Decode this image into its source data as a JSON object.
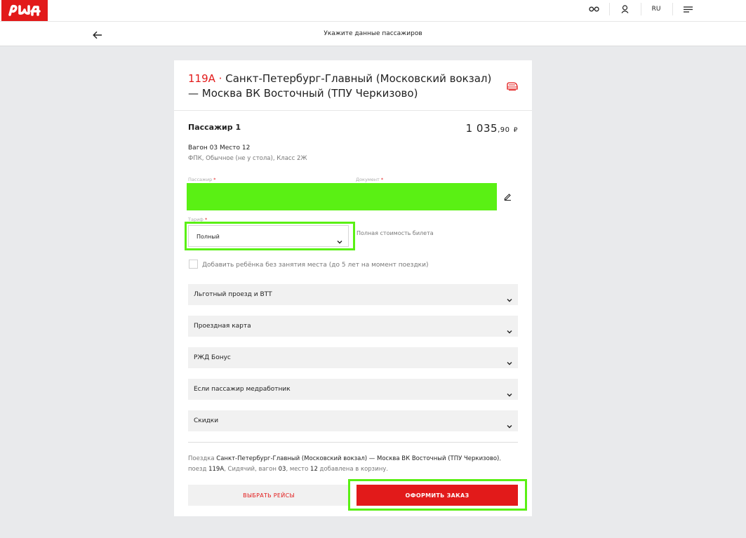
{
  "brand": {
    "logo_text": "РЖД",
    "accent_color": "#e21a1a",
    "highlight_color": "#5af014"
  },
  "topbar": {
    "icons": [
      "glasses-icon",
      "user-icon",
      "menu-icon"
    ],
    "lang": "RU"
  },
  "subheader": {
    "back_icon": "arrow-left-icon",
    "title": "Укажите данные пассажиров"
  },
  "trip": {
    "train_number": "119А",
    "separator": " · ",
    "route": "Санкт-Петербург-Главный (Московский вокзал) — Москва ВК Восточный (ТПУ Черкизово)",
    "train_icon": "train-icon"
  },
  "passenger": {
    "title": "Пассажир 1",
    "price_main": "1 035",
    "price_cents": ",90",
    "currency": "₽",
    "car_seat": "Вагон 03 Место 12",
    "class_info": "ФПК, Обычное (не у стола), Класс 2Ж",
    "passenger_label": "Пассажир",
    "document_label": "Документ",
    "required_mark": "*",
    "tariff_label": "Тариф",
    "tariff_value": "Полный",
    "tariff_note": "Полная стоимость билета",
    "child_checkbox_label": "Добавить ребёнка без занятия места (до 5 лет на момент поездки)",
    "child_checked": false
  },
  "accordions": [
    {
      "label": "Льготный проезд и ВТТ"
    },
    {
      "label": "Проездная карта"
    },
    {
      "label": "РЖД Бонус"
    },
    {
      "label": "Если пассажир медработник"
    },
    {
      "label": "Скидки"
    }
  ],
  "summary": {
    "p1": "Поездка ",
    "route": "Санкт-Петербург-Главный (Московский вокзал) — Москва ВК Восточный (ТПУ Черкизово)",
    "p2": ", поезд ",
    "train": "119А",
    "p3": ", Сидячий, вагон ",
    "car": "03",
    "p4": ", место ",
    "seat": "12",
    "p5": " добавлена в корзину."
  },
  "buttons": {
    "choose": "ВЫБРАТЬ РЕЙСЫ",
    "order": "ОФОРМИТЬ ЗАКАЗ"
  }
}
